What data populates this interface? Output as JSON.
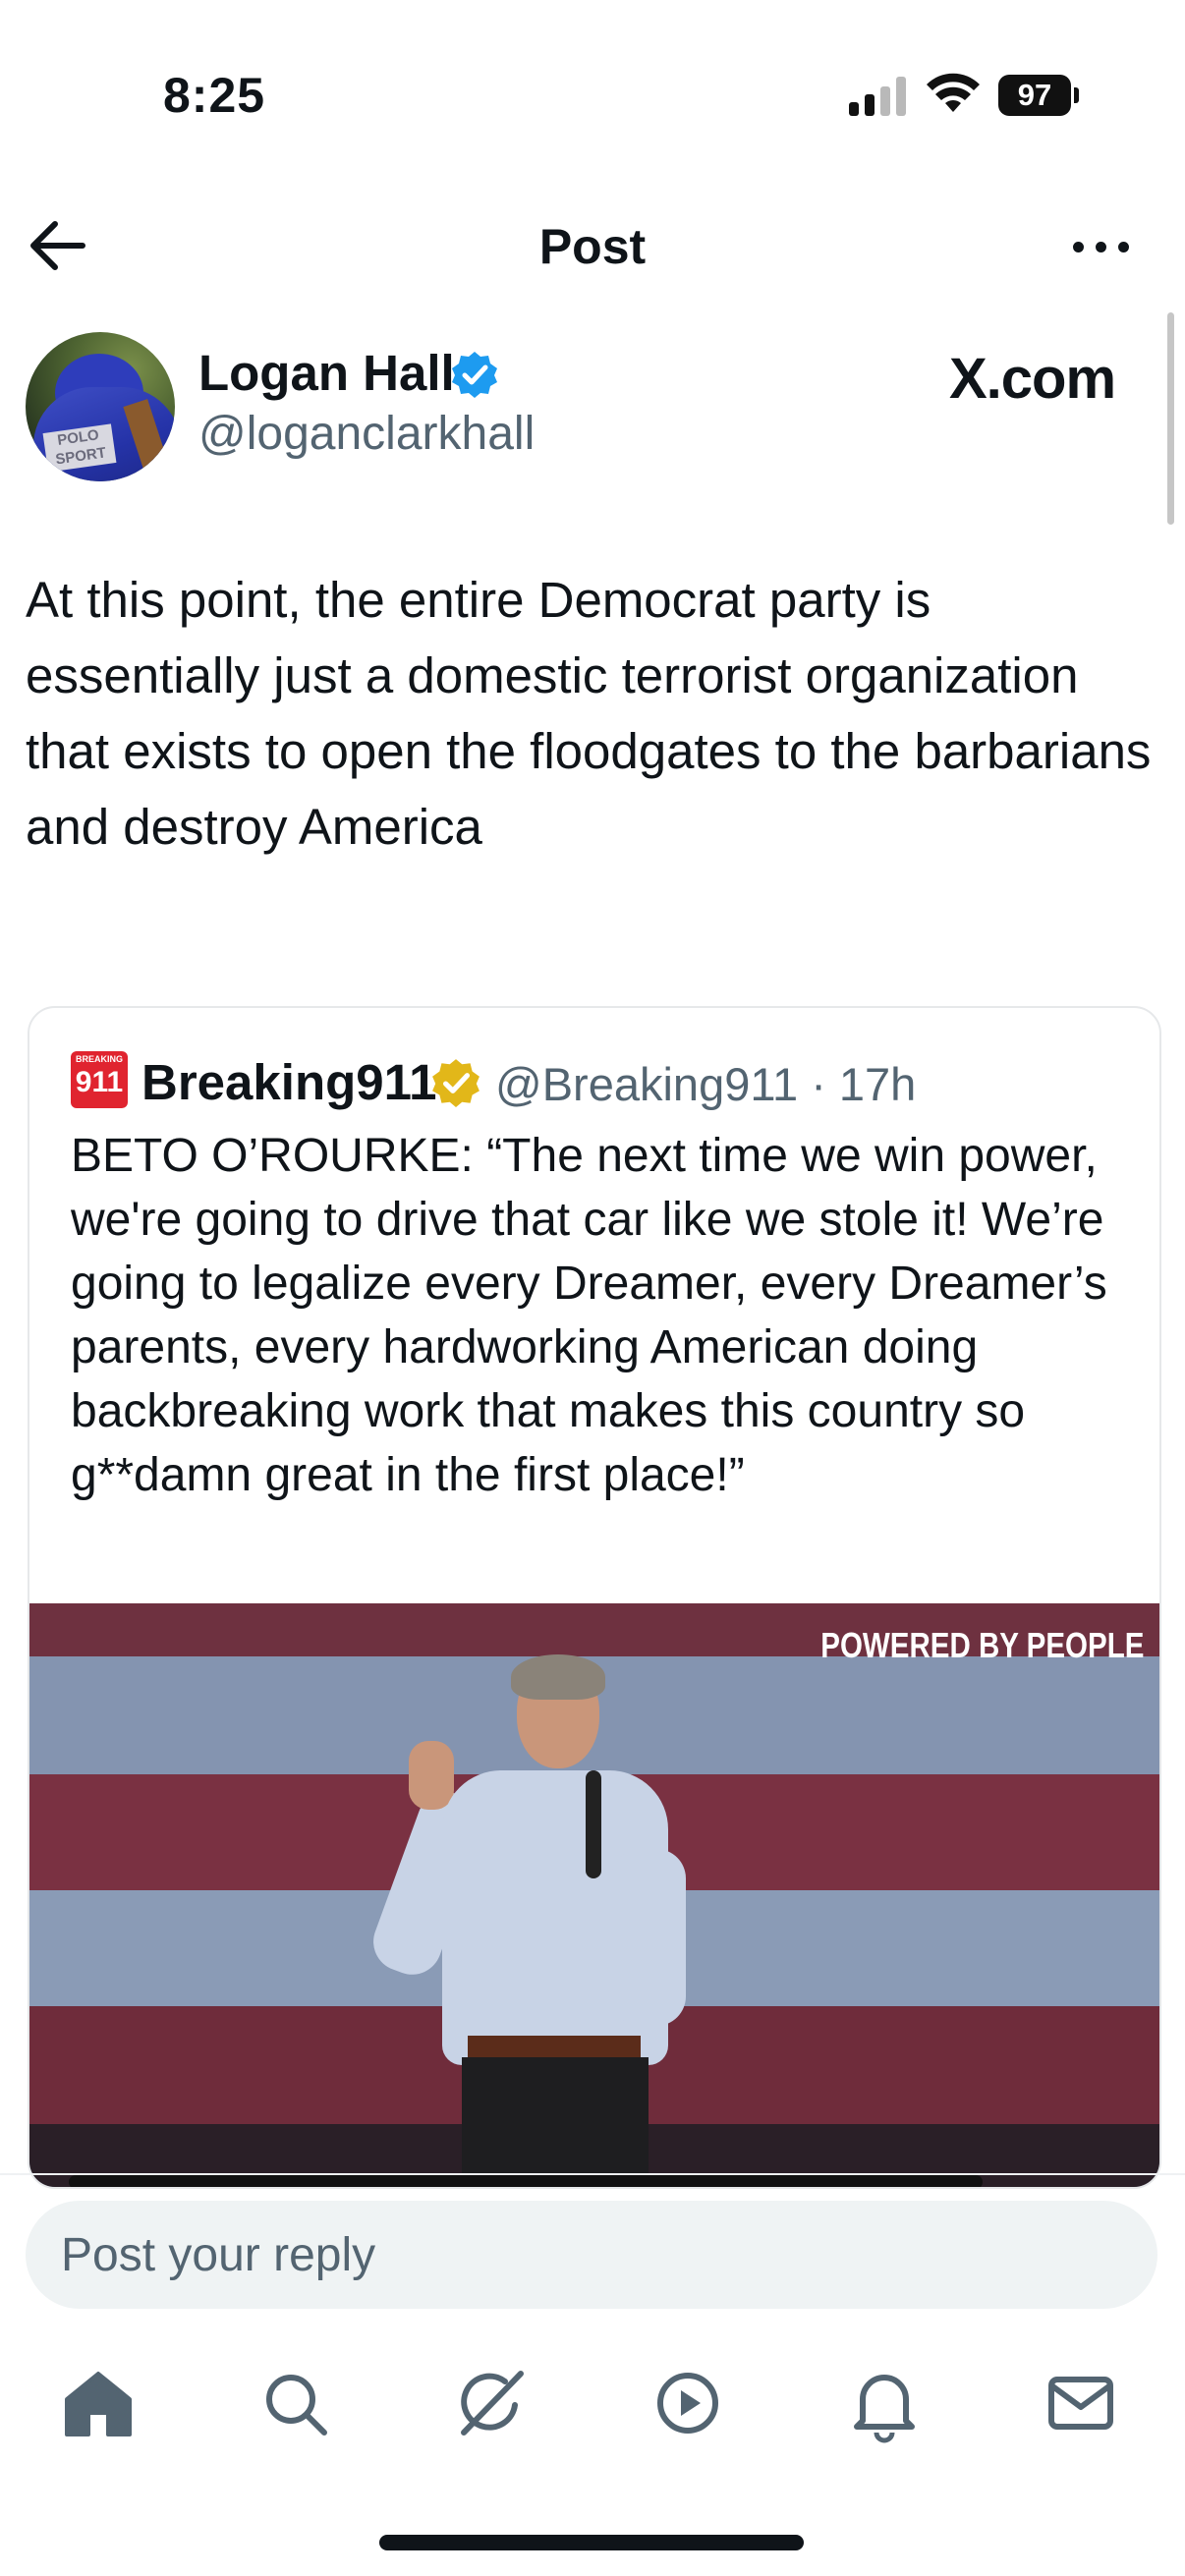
{
  "status_bar": {
    "time": "8:25",
    "battery": "97"
  },
  "nav": {
    "title": "Post"
  },
  "post": {
    "author_name": "Logan Hall",
    "author_handle": "@loganclarkhall",
    "source_logo": "X.com",
    "text": "At this point, the entire Democrat party is essentially just a domestic terrorist organization that exists to open the floodgates to the barbarians and destroy America",
    "avatar_text_1": "POLO",
    "avatar_text_2": "SPORT"
  },
  "quote": {
    "logo_text": "911",
    "logo_small_text": "BREAKING",
    "name": "Breaking911",
    "meta": "@Breaking911 · 17h",
    "text": "BETO O’ROURKE: “The next time we win power, we're going to drive that car like we stole it! We’re going to legalize every Dreamer, every Dreamer’s parents, every hardworking American doing backbreaking work that makes this country so g**damn great in the first place!”",
    "video_watermark": "POWERED BY PEOPLE"
  },
  "reply": {
    "placeholder": "Post your reply"
  },
  "colors": {
    "text": "#0f1419",
    "secondary": "#536471",
    "verified_blue": "#1d9bf0",
    "verified_gold": "#e2b719",
    "breaking_red": "#e0242f"
  },
  "tab_bar": {
    "icons": [
      "home-icon",
      "search-icon",
      "grok-icon",
      "video-icon",
      "notifications-icon",
      "messages-icon"
    ],
    "active": "home-icon"
  }
}
